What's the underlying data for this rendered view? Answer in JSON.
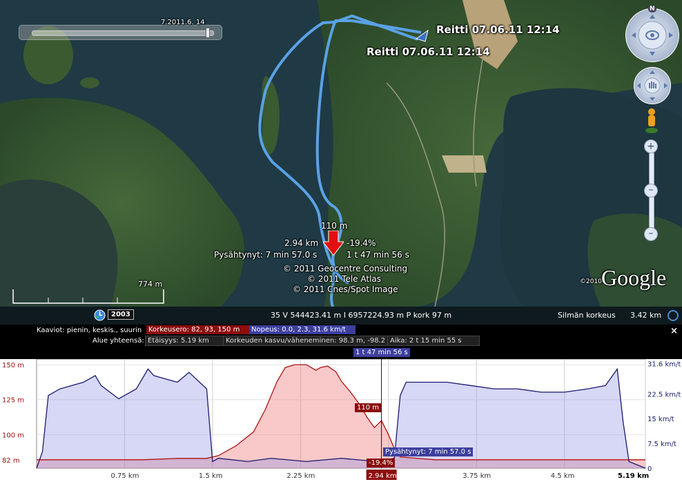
{
  "map": {
    "route_label_1": "Reitti 07.06.11 12:14",
    "route_label_2": "Reitti 07.06.11 12:14",
    "time_slider_date": "7.2011.6. 14",
    "marker": {
      "elevation": "110 m",
      "distance": "2.94 km",
      "slope": "-19.4%",
      "stopped": "Pysähtynyt: 7 min 57.0 s",
      "time": "1 t 47 min 56 s"
    },
    "copyright": [
      "© 2011 Geocentre Consulting",
      "© 2011 Tele Atlas",
      "© 2011 Cnes/Spot Image"
    ],
    "google_year": "©2010",
    "google_logo": "Google",
    "scale_label": "774 m",
    "compass_north": "N"
  },
  "statusbar": {
    "year": "2003",
    "coords": "35 V 544423.41 m I 6957224.93 m P kork   97 m",
    "eye_label": "Silmän korkeus",
    "eye_value": "3.42 km"
  },
  "profile": {
    "graphs_label": "Kaaviot: pienin, keskis., suurin",
    "elev_chip": "Korkeusero: 82, 93, 150 m",
    "speed_chip": "Nopeus: 0.0, 2.3, 31.6 km/t",
    "total_label": "Alue yhteensä:",
    "dist_chip": "Etäisyys: 5.19 km",
    "gain_chip": "Korkeuden kasvu/väheneminen: 98.3 m, -98.2 m",
    "time_chip": "Aika: 2 t 15 min 55 s",
    "cursor_time": "1 t 47 min 56 s",
    "cursor_elev": "110 m",
    "cursor_slope": "-19.4%",
    "cursor_dist": "2.94 km",
    "cursor_stop": "Pysähtynyt: 7 min 57.0 s",
    "close": "×"
  },
  "chart_data": {
    "type": "area",
    "left_axis": {
      "unit": "m",
      "ticks": [
        "150 m",
        "125 m",
        "100 m",
        "82 m"
      ],
      "values": [
        150,
        125,
        100,
        82
      ],
      "range": [
        76,
        154
      ]
    },
    "right_axis": {
      "unit": "km/t",
      "ticks": [
        "31.6 km/t",
        "22.5 km/t",
        "15 km/t",
        "7.5 km/t",
        "0"
      ],
      "values": [
        31.6,
        22.5,
        15,
        7.5,
        0
      ],
      "range": [
        0,
        33
      ]
    },
    "x_axis": {
      "unit": "km",
      "ticks": [
        "0.75 km",
        "1.5 km",
        "2.25 km",
        "3 km",
        "3.75 km",
        "4.5 km",
        "5.19 km"
      ],
      "values": [
        0.75,
        1.5,
        2.25,
        3.0,
        3.75,
        4.5,
        5.19
      ],
      "range": [
        0,
        5.19
      ]
    },
    "cursor_x": 2.94,
    "series": [
      {
        "name": "Korkeusero",
        "color": "#b01010",
        "x": [
          0,
          0.3,
          0.6,
          0.9,
          1.2,
          1.45,
          1.55,
          1.7,
          1.85,
          1.95,
          2.05,
          2.12,
          2.2,
          2.3,
          2.38,
          2.42,
          2.48,
          2.55,
          2.6,
          2.68,
          2.75,
          2.82,
          2.88,
          2.94,
          3.0,
          3.05,
          3.1,
          3.4,
          3.8,
          4.2,
          4.6,
          5.0,
          5.19
        ],
        "values": [
          82,
          82,
          82,
          82,
          83,
          83,
          85,
          92,
          102,
          118,
          138,
          148,
          150,
          150,
          146,
          148,
          149,
          145,
          138,
          130,
          122,
          112,
          105,
          110,
          100,
          90,
          84,
          82,
          82,
          82,
          82,
          82,
          82
        ]
      },
      {
        "name": "Nopeus",
        "color": "#1a1a6e",
        "x": [
          0,
          0.05,
          0.1,
          0.2,
          0.4,
          0.5,
          0.55,
          0.7,
          0.85,
          0.95,
          1.0,
          1.1,
          1.2,
          1.3,
          1.45,
          1.5,
          1.55,
          1.8,
          2.0,
          2.3,
          2.6,
          2.9,
          3.05,
          3.1,
          3.15,
          3.3,
          3.5,
          3.7,
          3.9,
          4.1,
          4.3,
          4.5,
          4.7,
          4.85,
          4.95,
          5.0,
          5.05,
          5.19
        ],
        "values": [
          0,
          5,
          22,
          24,
          26,
          28,
          25,
          21,
          24,
          30,
          28,
          27,
          26,
          29,
          24,
          2,
          3,
          2,
          3,
          2,
          3,
          2,
          3,
          22,
          26,
          26,
          26,
          25,
          24,
          24,
          23,
          23,
          24,
          25,
          30,
          14,
          2,
          0
        ]
      }
    ]
  }
}
